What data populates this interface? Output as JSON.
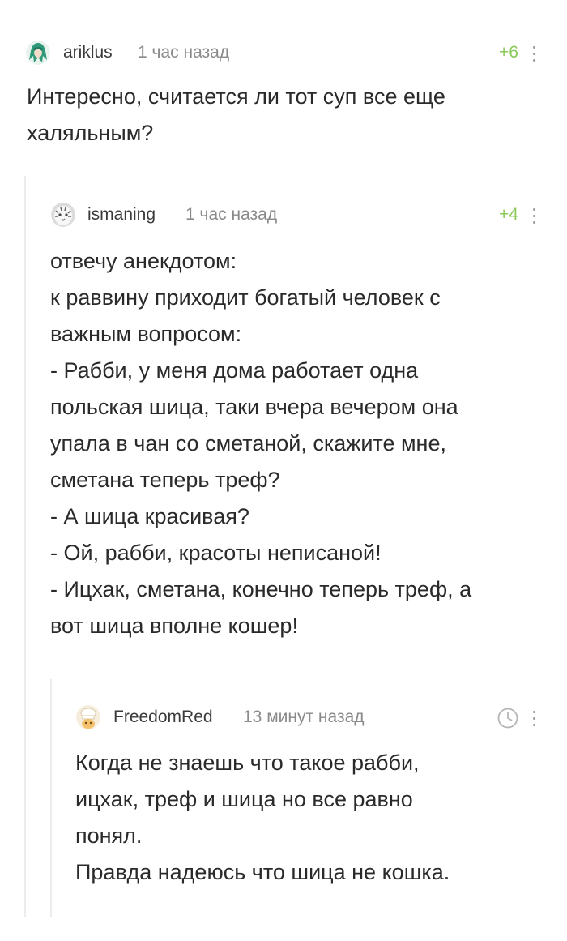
{
  "comments": [
    {
      "username": "ariklus",
      "time": "1 час назад",
      "rating": "+6",
      "avatar_icon": "green-haired-anime-avatar",
      "lines": [
        "Интересно, считается ли тот суп все еще",
        "халяльным?"
      ]
    },
    {
      "username": "ismaning",
      "time": "1 час назад",
      "rating": "+4",
      "avatar_icon": "white-tiger-avatar",
      "lines": [
        "отвечу анекдотом:",
        "к раввину приходит богатый человек с",
        "важным вопросом:",
        "- Рабби, у меня дома работает одна",
        "польская шица, таки вчера вечером она",
        "упала в чан со сметаной, скажите мне,",
        "сметана теперь треф?",
        "- А шица красивая?",
        "- Ой, рабби, красоты неписаной!",
        "- Ицхак, сметана, конечно теперь треф, а",
        "вот шица вполне кошер!"
      ]
    },
    {
      "username": "FreedomRed",
      "time": "13 минут назад",
      "rating_icon": "clock-icon",
      "avatar_icon": "chef-hat-avatar",
      "lines": [
        "Когда не знаешь что такое рабби,",
        "ицхак, треф и шица но все равно",
        "понял.",
        "Правда надеюсь что шица не кошка."
      ]
    }
  ],
  "colors": {
    "rating_positive": "#8ac858",
    "meta_gray": "#8a8a8a",
    "thread_line": "#ececec",
    "text": "#2a2a2a"
  }
}
